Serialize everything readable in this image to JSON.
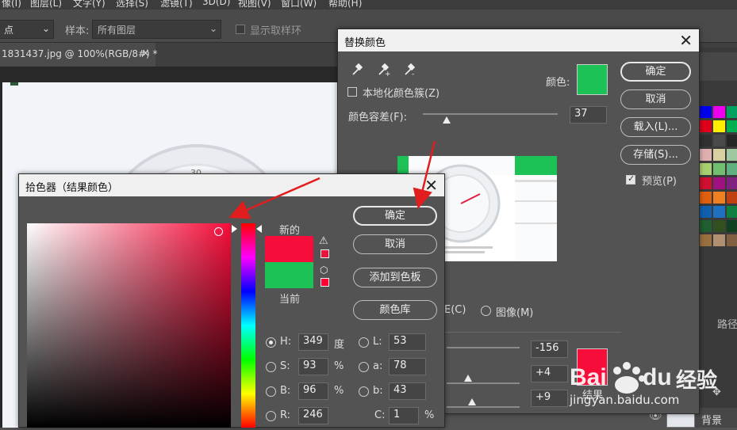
{
  "menu": [
    "像(I)",
    "图层(L)",
    "文字(Y)",
    "选择(S)",
    "滤镜(T)",
    "3D(D)",
    "视图(V)",
    "窗口(W)",
    "帮助(H)"
  ],
  "options_bar": {
    "sample_size_value": "点",
    "sample_label": "样本:",
    "sample_value": "所有图层",
    "show_ring_label": "显示取样环"
  },
  "document_tab": "1831437.jpg @ 100%(RGB/8#) *",
  "right_panel": {
    "tab_fragment": "路径",
    "layer_name": "背景"
  },
  "replace_color": {
    "title": "替换颜色",
    "localized_label": "本地化颜色簇(Z)",
    "tolerance_label": "颜色容差(F):",
    "tolerance_value": "37",
    "color_label": "颜色:",
    "selection_color": "#1dc257",
    "buttons": [
      "确定",
      "取消",
      "载入(L)...",
      "存储(S)..."
    ],
    "preview_label": "预览(P)",
    "preview_checked": true,
    "selection_radio_label": "E(C)",
    "image_radio_label": "图像(M)",
    "hue_value": "-156",
    "sat_value": "+4",
    "light_value": "+9",
    "result_label": "结果",
    "result_color": "#f60d3a"
  },
  "color_picker": {
    "title": "拾色器（结果颜色）",
    "new_label": "新的",
    "current_label": "当前",
    "new_color": "#f60d3a",
    "current_color": "#1dc257",
    "buttons": {
      "ok": "确定",
      "cancel": "取消",
      "add_swatch": "添加到色板",
      "color_library": "颜色库"
    },
    "hsb": [
      {
        "label": "H:",
        "value": "349",
        "unit": "度",
        "selected": true
      },
      {
        "label": "S:",
        "value": "93",
        "unit": "%",
        "selected": false
      },
      {
        "label": "B:",
        "value": "96",
        "unit": "%",
        "selected": false
      },
      {
        "label": "R:",
        "value": "246",
        "unit": "",
        "selected": false
      }
    ],
    "lab": [
      {
        "label": "L:",
        "value": "53"
      },
      {
        "label": "a:",
        "value": "78"
      },
      {
        "label": "b:",
        "value": "43"
      }
    ],
    "cmyk": {
      "label": "C:",
      "value": "1",
      "unit": "%"
    }
  },
  "watermark": {
    "brand": "Bai du 经验",
    "url": "jingyan.baidu.com"
  }
}
